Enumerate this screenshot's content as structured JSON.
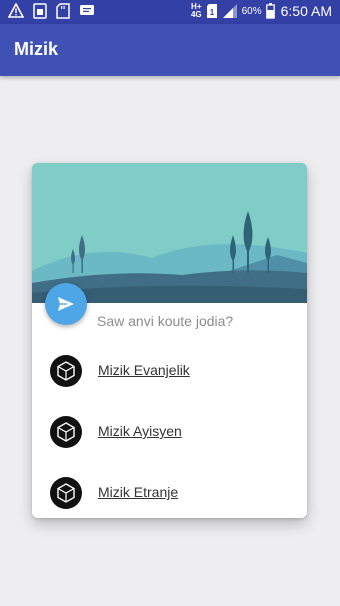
{
  "status_bar": {
    "network_top": "H+",
    "network_bottom": "4G",
    "battery_percent": "60%",
    "time": "6:50 AM",
    "icons": [
      "warning-icon",
      "sim-icon",
      "sd-card-icon",
      "message-icon",
      "battery-icon",
      "signal-icon"
    ]
  },
  "app_bar": {
    "title": "Mizik"
  },
  "card": {
    "question": "Saw anvi koute jodia?",
    "fab_icon": "send-icon",
    "items": [
      {
        "label": "Mizik Evanjelik",
        "icon": "music-icon"
      },
      {
        "label": "Mizik Ayisyen",
        "icon": "music-icon"
      },
      {
        "label": "Mizik Etranje",
        "icon": "music-icon"
      }
    ]
  },
  "colors": {
    "status_bar": "#3340a6",
    "app_bar": "#3f51b5",
    "fab": "#4ea6e6",
    "background": "#eeeef1",
    "header_sky": "#7fcdc6"
  }
}
